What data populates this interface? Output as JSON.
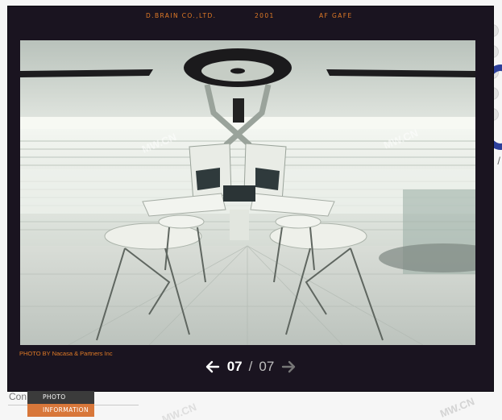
{
  "header": {
    "company": "D.BRAIN CO.,LTD.",
    "year": "2001",
    "project": "AF GAFE"
  },
  "photo": {
    "credit": "PHOTO BY Nacasa & Partners Inc",
    "watermark": "MW.CN"
  },
  "pager": {
    "current": "07",
    "separator": "/",
    "total": "07",
    "prev_icon": "arrow-left-icon",
    "next_icon": "arrow-right-icon"
  },
  "tabs": [
    {
      "label": "PHOTO"
    },
    {
      "label": "INFORMATION"
    }
  ],
  "background": {
    "left_text": "Con",
    "slash_text": "/",
    "watermark": "MW.CN"
  },
  "colors": {
    "accent": "#e07a26",
    "lightbox_bg": "#1a1420",
    "tab_photo": "#3b3b3b",
    "tab_info": "#d8773a"
  }
}
